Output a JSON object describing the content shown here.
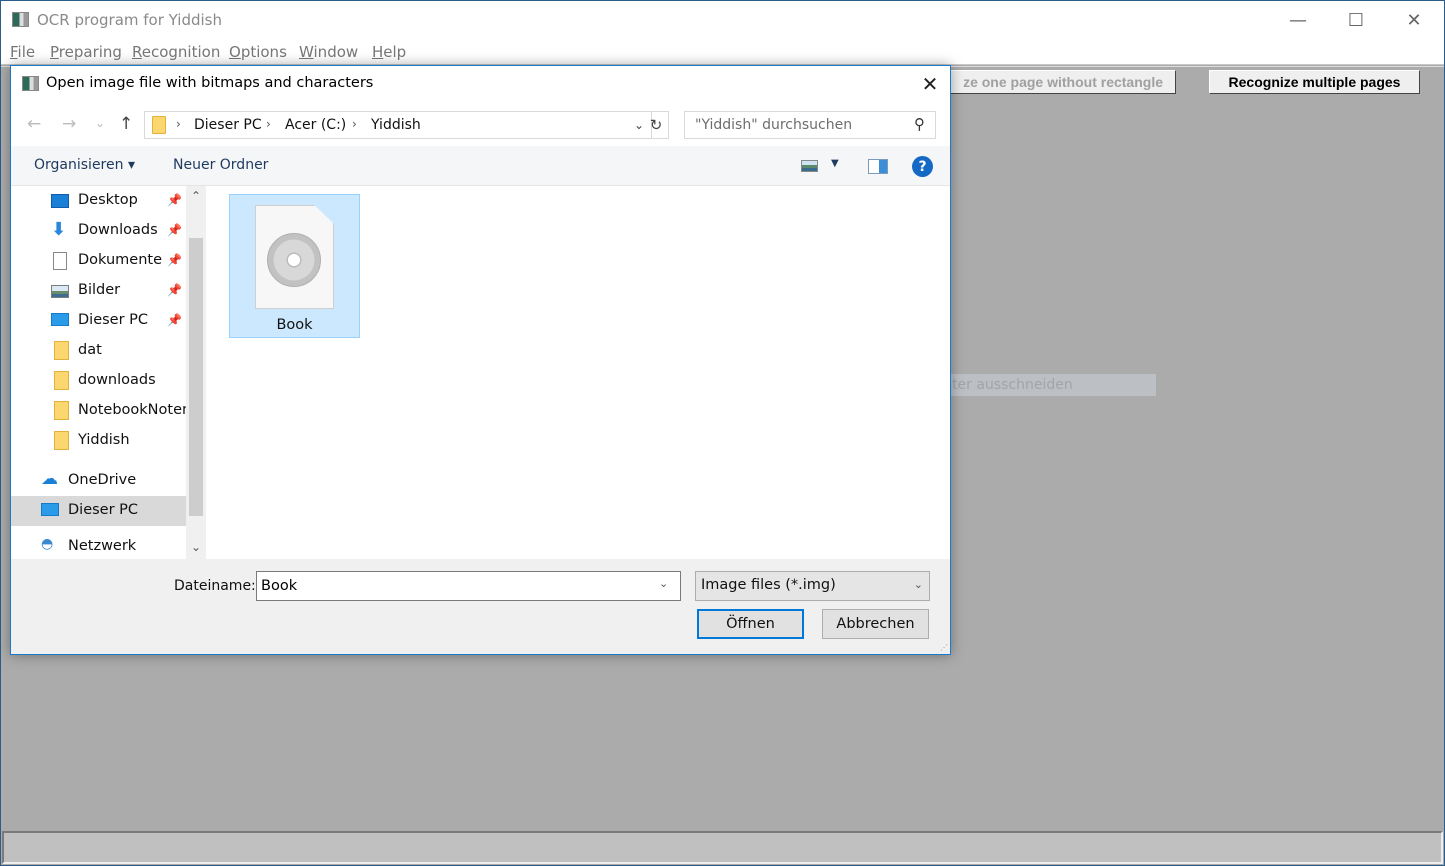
{
  "app": {
    "title": "OCR program for Yiddish",
    "window_controls": {
      "minimize": "—",
      "maximize": "☐",
      "close": "✕"
    },
    "menu": [
      {
        "label": "File",
        "underline": "F",
        "rest": "ile"
      },
      {
        "label": "Preparing",
        "underline": "P",
        "rest": "reparing"
      },
      {
        "label": "Recognition",
        "underline": "R",
        "rest": "ecognition"
      },
      {
        "label": "Options",
        "underline": "O",
        "rest": "ptions"
      },
      {
        "label": "Window",
        "underline": "W",
        "rest": "indow"
      },
      {
        "label": "Help",
        "underline": "H",
        "rest": "elp"
      }
    ],
    "toolbar": {
      "recognize_one_page": "Recognize one page without rectangle",
      "recognize_one_page_visible": "ze one page without rectangle",
      "recognize_multiple": "Recognize multiple pages"
    },
    "status_text": ""
  },
  "dialog": {
    "title": "Open image file with bitmaps and characters",
    "close": "✕",
    "nav": {
      "back": "←",
      "forward": "→",
      "recent": "⌄",
      "up": "↑"
    },
    "breadcrumb": [
      "Dieser PC",
      "Acer (C:)",
      "Yiddish"
    ],
    "breadcrumb_sep": "›",
    "search_placeholder": "\"Yiddish\" durchsuchen",
    "commands": {
      "organize": "Organisieren ▾",
      "new_folder": "Neuer Ordner",
      "help": "?"
    },
    "nav_pane": [
      {
        "label": "Desktop",
        "icon": "desktop",
        "pinned": true
      },
      {
        "label": "Downloads",
        "icon": "downloads",
        "pinned": true
      },
      {
        "label": "Dokumente",
        "icon": "documents",
        "pinned": true
      },
      {
        "label": "Bilder",
        "icon": "pictures",
        "pinned": true
      },
      {
        "label": "Dieser PC",
        "icon": "pc",
        "pinned": true
      },
      {
        "label": "dat",
        "icon": "folder",
        "pinned": false
      },
      {
        "label": "downloads",
        "icon": "folder",
        "pinned": false
      },
      {
        "label": "NotebookNoten",
        "icon": "folder",
        "pinned": false
      },
      {
        "label": "Yiddish",
        "icon": "folder",
        "pinned": false
      },
      {
        "label": "OneDrive",
        "icon": "onedrive",
        "pinned": false
      },
      {
        "label": "Dieser PC",
        "icon": "pc",
        "pinned": false,
        "selected": true
      },
      {
        "label": "Netzwerk",
        "icon": "network",
        "pinned": false
      }
    ],
    "files": [
      {
        "name": "Book",
        "selected": true
      }
    ],
    "filename_label": "Dateiname:",
    "filename_value": "Book",
    "filetype": "Image files (*.img)",
    "open_button": "Öffnen",
    "cancel_button": "Abbrechen"
  },
  "ghost_tooltip": "Fenster ausschneiden"
}
